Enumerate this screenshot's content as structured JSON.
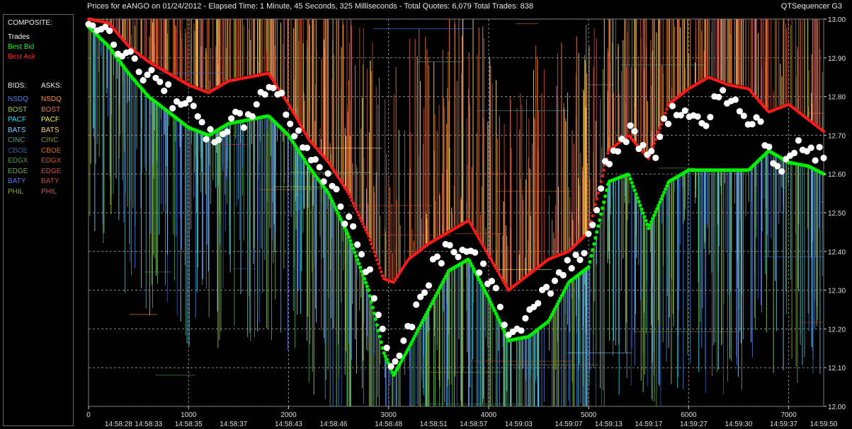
{
  "header": {
    "title": "Prices for  eANGO  on  01/24/2012  -  Elapsed Time: 1 Minute, 45 Seconds, 325 Milliseconds  -  Total Quotes: 6,079  Total Trades: 838",
    "app_name": "QTSequencer G3"
  },
  "legend": {
    "composite_label": "COMPOSITE:",
    "trades_label": "Trades",
    "best_bid_label": "Best Bid",
    "best_ask_label": "Best Ask",
    "bids_label": "BIDS:",
    "asks_label": "ASKS:",
    "exchanges": [
      {
        "name": "NSDQ",
        "bid_color": "#4a86e8",
        "ask_color": "#ff8c42"
      },
      {
        "name": "BOST",
        "bid_color": "#99cc66",
        "ask_color": "#e07840"
      },
      {
        "name": "PACF",
        "bid_color": "#33ddee",
        "ask_color": "#ffee55"
      },
      {
        "name": "BATS",
        "bid_color": "#88ccff",
        "ask_color": "#ffd27a"
      },
      {
        "name": "CINC",
        "bid_color": "#5c9ea0",
        "ask_color": "#8a8a40"
      },
      {
        "name": "CBOE",
        "bid_color": "#2a5caa",
        "ask_color": "#c07030"
      },
      {
        "name": "EDGX",
        "bid_color": "#4ca04c",
        "ask_color": "#c05a28"
      },
      {
        "name": "EDGE",
        "bid_color": "#6aaa5a",
        "ask_color": "#c8503a"
      },
      {
        "name": "BATY",
        "bid_color": "#5577dd",
        "ask_color": "#dd4433"
      },
      {
        "name": "PHIL",
        "bid_color": "#88aa33",
        "ask_color": "#cc5566"
      }
    ]
  },
  "colors": {
    "trades": "#ffffff",
    "best_bid": "#00ee00",
    "best_ask": "#ff1a1a",
    "grid": "#8a8a8a"
  },
  "chart_data": {
    "type": "scatter",
    "title": "Prices for  eANGO  on  01/24/2012",
    "xlim": [
      0,
      7350
    ],
    "ylim": [
      12.0,
      13.0
    ],
    "x_ticks": [
      0,
      1000,
      2000,
      3000,
      4000,
      5000,
      6000,
      7000
    ],
    "y_ticks": [
      "12.00",
      "12.10",
      "12.20",
      "12.30",
      "12.40",
      "12.50",
      "12.60",
      "12.70",
      "12.80",
      "12.90",
      "13.00"
    ],
    "time_labels": [
      {
        "x": 300,
        "label": "14:58:28"
      },
      {
        "x": 600,
        "label": "14:58:33"
      },
      {
        "x": 1000,
        "label": "14:58:35"
      },
      {
        "x": 1450,
        "label": "14:58:37"
      },
      {
        "x": 2000,
        "label": "14:58:43"
      },
      {
        "x": 2450,
        "label": "14:58:46"
      },
      {
        "x": 3000,
        "label": "14:58:48"
      },
      {
        "x": 3450,
        "label": "14:58:51"
      },
      {
        "x": 3850,
        "label": "14:58:57"
      },
      {
        "x": 4300,
        "label": "14:59:03"
      },
      {
        "x": 4800,
        "label": "14:59:07"
      },
      {
        "x": 5200,
        "label": "14:59:13"
      },
      {
        "x": 5600,
        "label": "14:59:17"
      },
      {
        "x": 6050,
        "label": "14:59:27"
      },
      {
        "x": 6500,
        "label": "14:59:30"
      },
      {
        "x": 6950,
        "label": "14:59:37"
      },
      {
        "x": 7350,
        "label": "14:59:50"
      }
    ],
    "trades_path": [
      [
        0,
        12.99
      ],
      [
        150,
        12.97
      ],
      [
        250,
        12.94
      ],
      [
        350,
        12.92
      ],
      [
        450,
        12.9
      ],
      [
        550,
        12.86
      ],
      [
        650,
        12.84
      ],
      [
        750,
        12.83
      ],
      [
        850,
        12.79
      ],
      [
        950,
        12.8
      ],
      [
        1050,
        12.76
      ],
      [
        1150,
        12.7
      ],
      [
        1250,
        12.69
      ],
      [
        1350,
        12.72
      ],
      [
        1450,
        12.74
      ],
      [
        1550,
        12.73
      ],
      [
        1650,
        12.77
      ],
      [
        1750,
        12.82
      ],
      [
        1850,
        12.83
      ],
      [
        1950,
        12.78
      ],
      [
        2050,
        12.72
      ],
      [
        2150,
        12.68
      ],
      [
        2250,
        12.64
      ],
      [
        2350,
        12.6
      ],
      [
        2450,
        12.56
      ],
      [
        2550,
        12.5
      ],
      [
        2650,
        12.45
      ],
      [
        2750,
        12.38
      ],
      [
        2850,
        12.3
      ],
      [
        2950,
        12.2
      ],
      [
        3000,
        12.13
      ],
      [
        3080,
        12.1
      ],
      [
        3150,
        12.17
      ],
      [
        3250,
        12.24
      ],
      [
        3350,
        12.3
      ],
      [
        3450,
        12.37
      ],
      [
        3550,
        12.4
      ],
      [
        3650,
        12.42
      ],
      [
        3750,
        12.4
      ],
      [
        3850,
        12.38
      ],
      [
        3950,
        12.36
      ],
      [
        4050,
        12.3
      ],
      [
        4150,
        12.23
      ],
      [
        4250,
        12.18
      ],
      [
        4350,
        12.2
      ],
      [
        4450,
        12.25
      ],
      [
        4550,
        12.28
      ],
      [
        4650,
        12.32
      ],
      [
        4750,
        12.36
      ],
      [
        4850,
        12.37
      ],
      [
        4950,
        12.4
      ],
      [
        5050,
        12.48
      ],
      [
        5150,
        12.62
      ],
      [
        5250,
        12.66
      ],
      [
        5350,
        12.68
      ],
      [
        5450,
        12.72
      ],
      [
        5550,
        12.66
      ],
      [
        5650,
        12.63
      ],
      [
        5750,
        12.74
      ],
      [
        5850,
        12.77
      ],
      [
        5950,
        12.76
      ],
      [
        6050,
        12.75
      ],
      [
        6150,
        12.73
      ],
      [
        6250,
        12.78
      ],
      [
        6350,
        12.81
      ],
      [
        6450,
        12.8
      ],
      [
        6550,
        12.75
      ],
      [
        6650,
        12.74
      ],
      [
        6750,
        12.7
      ],
      [
        6850,
        12.63
      ],
      [
        6950,
        12.61
      ],
      [
        7050,
        12.66
      ],
      [
        7150,
        12.69
      ],
      [
        7250,
        12.66
      ],
      [
        7350,
        12.64
      ]
    ],
    "best_bid_path": [
      [
        0,
        12.98
      ],
      [
        200,
        12.93
      ],
      [
        400,
        12.86
      ],
      [
        600,
        12.8
      ],
      [
        800,
        12.76
      ],
      [
        1000,
        12.72
      ],
      [
        1200,
        12.7
      ],
      [
        1400,
        12.73
      ],
      [
        1600,
        12.74
      ],
      [
        1800,
        12.75
      ],
      [
        2000,
        12.7
      ],
      [
        2200,
        12.62
      ],
      [
        2400,
        12.55
      ],
      [
        2600,
        12.44
      ],
      [
        2800,
        12.3
      ],
      [
        2950,
        12.14
      ],
      [
        3050,
        12.08
      ],
      [
        3200,
        12.15
      ],
      [
        3400,
        12.25
      ],
      [
        3600,
        12.35
      ],
      [
        3800,
        12.38
      ],
      [
        4000,
        12.28
      ],
      [
        4200,
        12.17
      ],
      [
        4400,
        12.18
      ],
      [
        4600,
        12.22
      ],
      [
        4800,
        12.32
      ],
      [
        5000,
        12.36
      ],
      [
        5200,
        12.58
      ],
      [
        5400,
        12.6
      ],
      [
        5600,
        12.46
      ],
      [
        5800,
        12.58
      ],
      [
        6000,
        12.61
      ],
      [
        6200,
        12.61
      ],
      [
        6400,
        12.61
      ],
      [
        6600,
        12.61
      ],
      [
        6800,
        12.66
      ],
      [
        7000,
        12.63
      ],
      [
        7200,
        12.62
      ],
      [
        7350,
        12.6
      ]
    ],
    "best_ask_path": [
      [
        0,
        13.0
      ],
      [
        200,
        12.99
      ],
      [
        400,
        12.93
      ],
      [
        600,
        12.89
      ],
      [
        800,
        12.86
      ],
      [
        1000,
        12.83
      ],
      [
        1200,
        12.81
      ],
      [
        1400,
        12.84
      ],
      [
        1600,
        12.85
      ],
      [
        1800,
        12.86
      ],
      [
        2000,
        12.78
      ],
      [
        2200,
        12.69
      ],
      [
        2400,
        12.63
      ],
      [
        2600,
        12.55
      ],
      [
        2800,
        12.44
      ],
      [
        2950,
        12.33
      ],
      [
        3050,
        12.32
      ],
      [
        3200,
        12.38
      ],
      [
        3400,
        12.42
      ],
      [
        3600,
        12.45
      ],
      [
        3800,
        12.48
      ],
      [
        4000,
        12.39
      ],
      [
        4200,
        12.3
      ],
      [
        4400,
        12.34
      ],
      [
        4600,
        12.38
      ],
      [
        4800,
        12.4
      ],
      [
        5000,
        12.45
      ],
      [
        5200,
        12.66
      ],
      [
        5400,
        12.7
      ],
      [
        5600,
        12.64
      ],
      [
        5800,
        12.78
      ],
      [
        6000,
        12.82
      ],
      [
        6200,
        12.85
      ],
      [
        6400,
        12.83
      ],
      [
        6600,
        12.82
      ],
      [
        6800,
        12.76
      ],
      [
        7000,
        12.78
      ],
      [
        7200,
        12.74
      ],
      [
        7350,
        12.71
      ]
    ]
  }
}
